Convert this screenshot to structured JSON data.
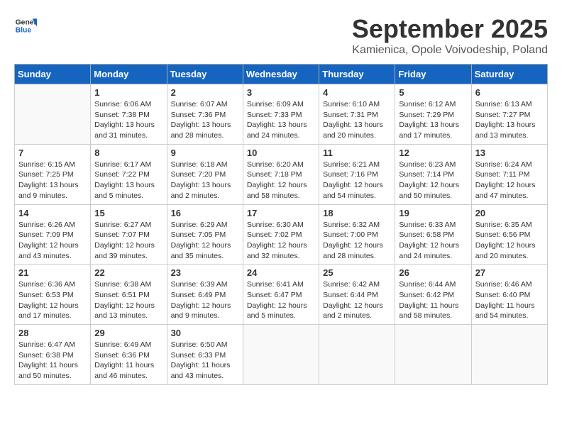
{
  "header": {
    "logo_line1": "General",
    "logo_line2": "Blue",
    "month": "September 2025",
    "location": "Kamienica, Opole Voivodeship, Poland"
  },
  "days_of_week": [
    "Sunday",
    "Monday",
    "Tuesday",
    "Wednesday",
    "Thursday",
    "Friday",
    "Saturday"
  ],
  "weeks": [
    [
      {
        "day": null,
        "info": null
      },
      {
        "day": "1",
        "info": "Sunrise: 6:06 AM\nSunset: 7:38 PM\nDaylight: 13 hours\nand 31 minutes."
      },
      {
        "day": "2",
        "info": "Sunrise: 6:07 AM\nSunset: 7:36 PM\nDaylight: 13 hours\nand 28 minutes."
      },
      {
        "day": "3",
        "info": "Sunrise: 6:09 AM\nSunset: 7:33 PM\nDaylight: 13 hours\nand 24 minutes."
      },
      {
        "day": "4",
        "info": "Sunrise: 6:10 AM\nSunset: 7:31 PM\nDaylight: 13 hours\nand 20 minutes."
      },
      {
        "day": "5",
        "info": "Sunrise: 6:12 AM\nSunset: 7:29 PM\nDaylight: 13 hours\nand 17 minutes."
      },
      {
        "day": "6",
        "info": "Sunrise: 6:13 AM\nSunset: 7:27 PM\nDaylight: 13 hours\nand 13 minutes."
      }
    ],
    [
      {
        "day": "7",
        "info": "Sunrise: 6:15 AM\nSunset: 7:25 PM\nDaylight: 13 hours\nand 9 minutes."
      },
      {
        "day": "8",
        "info": "Sunrise: 6:17 AM\nSunset: 7:22 PM\nDaylight: 13 hours\nand 5 minutes."
      },
      {
        "day": "9",
        "info": "Sunrise: 6:18 AM\nSunset: 7:20 PM\nDaylight: 13 hours\nand 2 minutes."
      },
      {
        "day": "10",
        "info": "Sunrise: 6:20 AM\nSunset: 7:18 PM\nDaylight: 12 hours\nand 58 minutes."
      },
      {
        "day": "11",
        "info": "Sunrise: 6:21 AM\nSunset: 7:16 PM\nDaylight: 12 hours\nand 54 minutes."
      },
      {
        "day": "12",
        "info": "Sunrise: 6:23 AM\nSunset: 7:14 PM\nDaylight: 12 hours\nand 50 minutes."
      },
      {
        "day": "13",
        "info": "Sunrise: 6:24 AM\nSunset: 7:11 PM\nDaylight: 12 hours\nand 47 minutes."
      }
    ],
    [
      {
        "day": "14",
        "info": "Sunrise: 6:26 AM\nSunset: 7:09 PM\nDaylight: 12 hours\nand 43 minutes."
      },
      {
        "day": "15",
        "info": "Sunrise: 6:27 AM\nSunset: 7:07 PM\nDaylight: 12 hours\nand 39 minutes."
      },
      {
        "day": "16",
        "info": "Sunrise: 6:29 AM\nSunset: 7:05 PM\nDaylight: 12 hours\nand 35 minutes."
      },
      {
        "day": "17",
        "info": "Sunrise: 6:30 AM\nSunset: 7:02 PM\nDaylight: 12 hours\nand 32 minutes."
      },
      {
        "day": "18",
        "info": "Sunrise: 6:32 AM\nSunset: 7:00 PM\nDaylight: 12 hours\nand 28 minutes."
      },
      {
        "day": "19",
        "info": "Sunrise: 6:33 AM\nSunset: 6:58 PM\nDaylight: 12 hours\nand 24 minutes."
      },
      {
        "day": "20",
        "info": "Sunrise: 6:35 AM\nSunset: 6:56 PM\nDaylight: 12 hours\nand 20 minutes."
      }
    ],
    [
      {
        "day": "21",
        "info": "Sunrise: 6:36 AM\nSunset: 6:53 PM\nDaylight: 12 hours\nand 17 minutes."
      },
      {
        "day": "22",
        "info": "Sunrise: 6:38 AM\nSunset: 6:51 PM\nDaylight: 12 hours\nand 13 minutes."
      },
      {
        "day": "23",
        "info": "Sunrise: 6:39 AM\nSunset: 6:49 PM\nDaylight: 12 hours\nand 9 minutes."
      },
      {
        "day": "24",
        "info": "Sunrise: 6:41 AM\nSunset: 6:47 PM\nDaylight: 12 hours\nand 5 minutes."
      },
      {
        "day": "25",
        "info": "Sunrise: 6:42 AM\nSunset: 6:44 PM\nDaylight: 12 hours\nand 2 minutes."
      },
      {
        "day": "26",
        "info": "Sunrise: 6:44 AM\nSunset: 6:42 PM\nDaylight: 11 hours\nand 58 minutes."
      },
      {
        "day": "27",
        "info": "Sunrise: 6:46 AM\nSunset: 6:40 PM\nDaylight: 11 hours\nand 54 minutes."
      }
    ],
    [
      {
        "day": "28",
        "info": "Sunrise: 6:47 AM\nSunset: 6:38 PM\nDaylight: 11 hours\nand 50 minutes."
      },
      {
        "day": "29",
        "info": "Sunrise: 6:49 AM\nSunset: 6:36 PM\nDaylight: 11 hours\nand 46 minutes."
      },
      {
        "day": "30",
        "info": "Sunrise: 6:50 AM\nSunset: 6:33 PM\nDaylight: 11 hours\nand 43 minutes."
      },
      {
        "day": null,
        "info": null
      },
      {
        "day": null,
        "info": null
      },
      {
        "day": null,
        "info": null
      },
      {
        "day": null,
        "info": null
      }
    ]
  ]
}
